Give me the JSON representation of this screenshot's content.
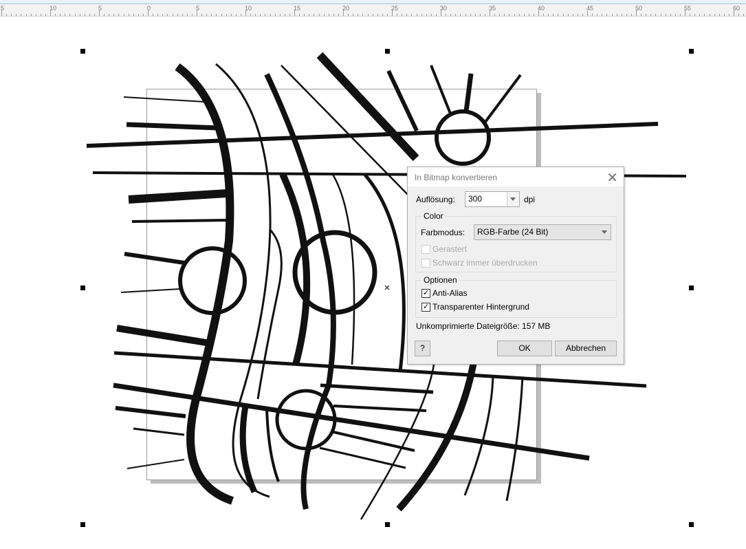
{
  "ruler": {
    "labels": [
      "5",
      "10",
      "5",
      "0",
      "5",
      "10",
      "15",
      "20",
      "25",
      "30",
      "35",
      "40",
      "45",
      "50",
      "55",
      "60"
    ]
  },
  "dialog": {
    "title": "In Bitmap konvertieren",
    "close_icon": "close-icon",
    "resolution_label": "Auflösung:",
    "resolution_value": "300",
    "resolution_unit": "dpi",
    "color_group": "Color",
    "color_mode_label": "Farbmodus:",
    "color_mode_value": "RGB-Farbe (24 Bit)",
    "dithered_label": "Gerastert",
    "dithered_checked": false,
    "overprint_label": "Schwarz immer überdrucken",
    "overprint_checked": false,
    "options_group": "Optionen",
    "antialias_label": "Anti-Alias",
    "antialias_checked": true,
    "transparent_label": "Transparenter Hintergrund",
    "transparent_checked": true,
    "filesize_text": "Unkomprimierte Dateigröße: 157 MB",
    "help_label": "?",
    "ok_label": "OK",
    "cancel_label": "Abbrechen"
  }
}
